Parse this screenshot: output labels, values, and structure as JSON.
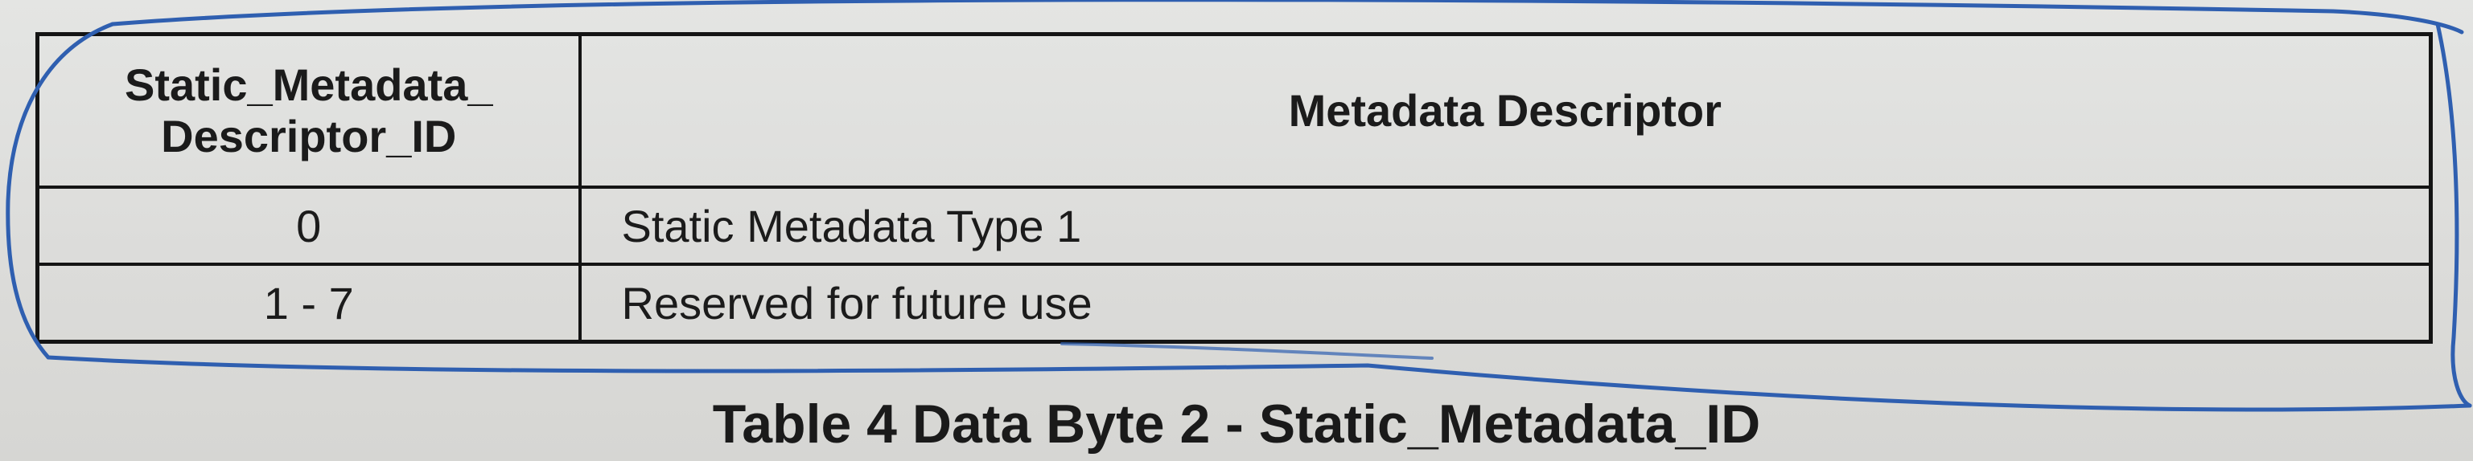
{
  "table": {
    "header": {
      "id_column": "Static_Metadata_\nDescriptor_ID",
      "descriptor_column": "Metadata Descriptor"
    },
    "rows": [
      {
        "id": "0",
        "descriptor": "Static Metadata Type 1"
      },
      {
        "id": "1 - 7",
        "descriptor": "Reserved for future use"
      }
    ]
  },
  "caption": "Table 4 Data Byte 2 - Static_Metadata_ID",
  "colors": {
    "ink": "#141414",
    "paper": "#dedfdc",
    "pen_annotation": "#2f5fb0"
  }
}
